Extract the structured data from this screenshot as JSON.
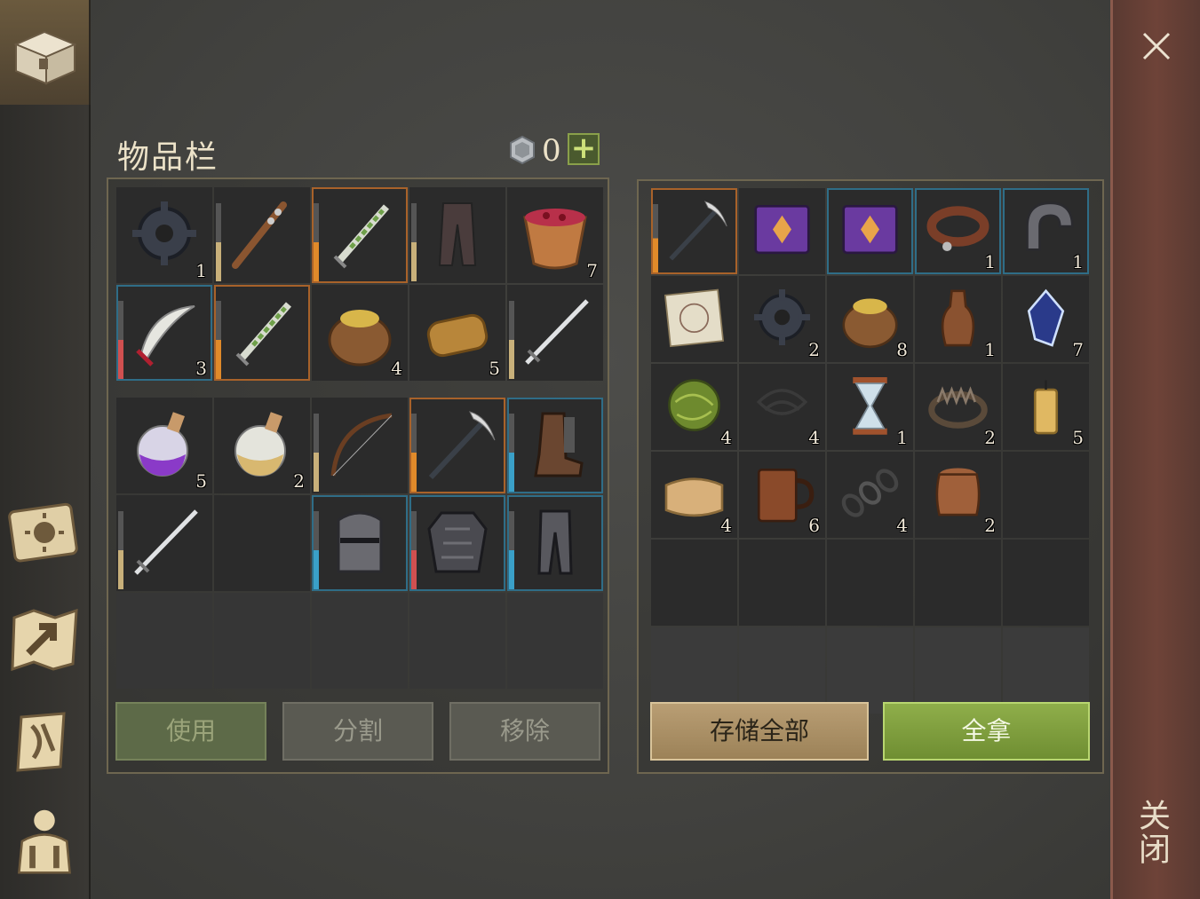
{
  "header": {
    "title": "物品栏",
    "currency_count": "0",
    "add_label": "+"
  },
  "close": {
    "label": "关闭"
  },
  "inventory": {
    "slots": [
      {
        "icon": "gear-icon",
        "count": "1",
        "bar": "none",
        "frame": "none"
      },
      {
        "icon": "spiked-club-icon",
        "count": "",
        "bar": "tan",
        "frame": "none"
      },
      {
        "icon": "herb-dagger-icon",
        "count": "",
        "bar": "orange",
        "frame": "orange"
      },
      {
        "icon": "leather-pants-icon",
        "count": "",
        "bar": "tan",
        "frame": "none"
      },
      {
        "icon": "berry-bowl-icon",
        "count": "7",
        "bar": "none",
        "frame": "none"
      },
      {
        "icon": "scimitar-icon",
        "count": "3",
        "bar": "red",
        "frame": "blue"
      },
      {
        "icon": "herb-dagger-icon",
        "count": "",
        "bar": "orange",
        "frame": "orange"
      },
      {
        "icon": "grain-sack-icon",
        "count": "4",
        "bar": "none",
        "frame": "none"
      },
      {
        "icon": "bread-loaf-icon",
        "count": "5",
        "bar": "none",
        "frame": "none"
      },
      {
        "icon": "sword-icon",
        "count": "",
        "bar": "tan",
        "frame": "none"
      },
      {
        "icon": "purple-potion-icon",
        "count": "5",
        "bar": "none",
        "frame": "none"
      },
      {
        "icon": "gold-potion-icon",
        "count": "2",
        "bar": "none",
        "frame": "none"
      },
      {
        "icon": "bow-icon",
        "count": "",
        "bar": "tan",
        "frame": "none"
      },
      {
        "icon": "pickaxe-icon",
        "count": "",
        "bar": "orange",
        "frame": "orange"
      },
      {
        "icon": "boots-icon",
        "count": "",
        "bar": "blue",
        "frame": "blue"
      },
      {
        "icon": "sword-icon",
        "count": "",
        "bar": "tan",
        "frame": "none"
      },
      {
        "icon": "empty-slot",
        "count": "",
        "bar": "none",
        "frame": "none"
      },
      {
        "icon": "helmet-icon",
        "count": "",
        "bar": "blue",
        "frame": "blue"
      },
      {
        "icon": "chainmail-icon",
        "count": "",
        "bar": "red",
        "frame": "blue"
      },
      {
        "icon": "armored-greaves-icon",
        "count": "",
        "bar": "blue",
        "frame": "blue"
      }
    ],
    "buttons": {
      "use": "使用",
      "split": "分割",
      "remove": "移除"
    }
  },
  "container": {
    "slots": [
      {
        "icon": "pickaxe-icon",
        "count": "",
        "bar": "orange",
        "frame": "orange"
      },
      {
        "icon": "purple-book-icon",
        "count": "",
        "bar": "none",
        "frame": "none"
      },
      {
        "icon": "purple-book-icon",
        "count": "",
        "bar": "none",
        "frame": "blue"
      },
      {
        "icon": "collar-icon",
        "count": "1",
        "bar": "none",
        "frame": "blue"
      },
      {
        "icon": "shackle-icon",
        "count": "1",
        "bar": "none",
        "frame": "blue"
      },
      {
        "icon": "blueprint-icon",
        "count": "",
        "bar": "none",
        "frame": "none"
      },
      {
        "icon": "gear-icon",
        "count": "2",
        "bar": "none",
        "frame": "none"
      },
      {
        "icon": "grain-sack-icon",
        "count": "8",
        "bar": "none",
        "frame": "none"
      },
      {
        "icon": "flask-icon",
        "count": "1",
        "bar": "none",
        "frame": "none"
      },
      {
        "icon": "crystal-icon",
        "count": "7",
        "bar": "none",
        "frame": "none"
      },
      {
        "icon": "herb-ball-icon",
        "count": "4",
        "bar": "none",
        "frame": "none"
      },
      {
        "icon": "wire-icon",
        "count": "4",
        "bar": "none",
        "frame": "none"
      },
      {
        "icon": "hourglass-icon",
        "count": "1",
        "bar": "none",
        "frame": "none"
      },
      {
        "icon": "bear-trap-icon",
        "count": "2",
        "bar": "none",
        "frame": "none"
      },
      {
        "icon": "candle-icon",
        "count": "5",
        "bar": "none",
        "frame": "none"
      },
      {
        "icon": "cloth-icon",
        "count": "4",
        "bar": "none",
        "frame": "none"
      },
      {
        "icon": "mug-icon",
        "count": "6",
        "bar": "none",
        "frame": "none"
      },
      {
        "icon": "chain-icon",
        "count": "4",
        "bar": "none",
        "frame": "none"
      },
      {
        "icon": "barrel-icon",
        "count": "2",
        "bar": "none",
        "frame": "none"
      }
    ],
    "buttons": {
      "store_all": "存储全部",
      "take_all": "全拿"
    }
  }
}
